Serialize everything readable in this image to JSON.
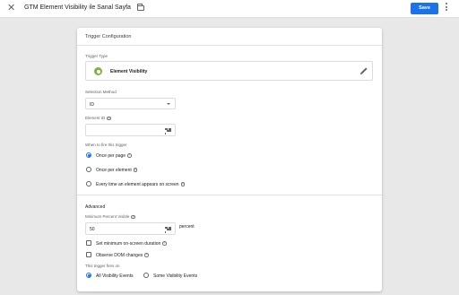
{
  "header": {
    "title": "GTM Element Visibility ile Sanal Sayfa",
    "save_label": "Save",
    "close_icon": "close-icon",
    "folder_icon": "folder-icon",
    "more_icon": "more-vert-icon"
  },
  "colors": {
    "accent": "#1a73e8",
    "trigger_icon": "#7cb342"
  },
  "card": {
    "title": "Trigger Configuration",
    "trigger_type_label": "Trigger Type",
    "trigger_type_name": "Element Visibility",
    "selection_method_label": "Selection Method",
    "selection_method_value": "ID",
    "element_id_label": "Element ID",
    "element_id_value": "",
    "fire_label": "When to fire this trigger",
    "fire_options": [
      {
        "label": "Once per page",
        "selected": true
      },
      {
        "label": "Once per element",
        "selected": false
      },
      {
        "label": "Every time an element appears on screen",
        "selected": false
      }
    ],
    "advanced_label": "Advanced",
    "min_percent_label": "Minimum Percent Visible",
    "min_percent_value": "50",
    "percent_unit": "percent",
    "checkboxes": [
      {
        "label": "Set minimum on-screen duration",
        "checked": false
      },
      {
        "label": "Observe DOM changes",
        "checked": false
      }
    ],
    "fires_on_label": "This trigger fires on",
    "fires_on_options": [
      {
        "label": "All Visibility Events",
        "selected": true
      },
      {
        "label": "Some Visibility Events",
        "selected": false
      }
    ]
  }
}
